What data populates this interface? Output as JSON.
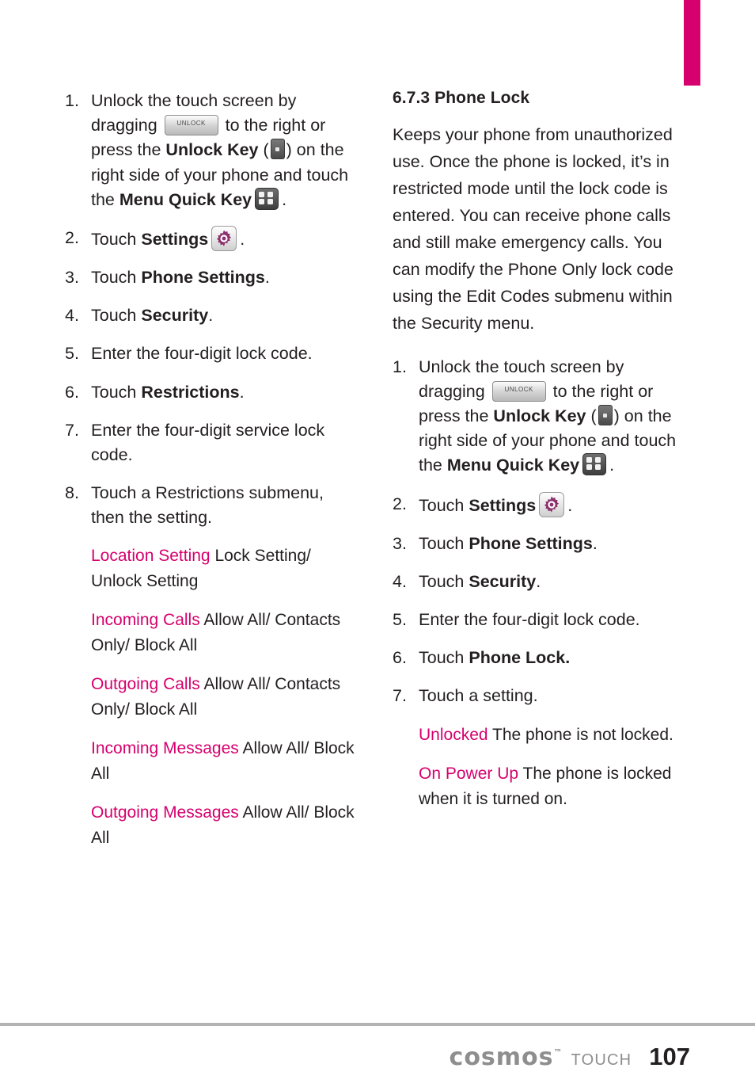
{
  "page": {
    "number": "107",
    "brand": "cosmos",
    "brand_sup": "™",
    "brand_suffix": "TOUCH"
  },
  "icons": {
    "unlock_chip_label": "UNLOCK",
    "unlock_key": "unlock-key-icon",
    "menu_quick_key": "menu-quick-key-icon",
    "settings_gear": "settings-gear-icon"
  },
  "left_column": {
    "steps": [
      {
        "num": "1.",
        "parts": [
          {
            "t": "text",
            "v": "Unlock the touch screen by dragging "
          },
          {
            "t": "icon",
            "v": "unlock-chip"
          },
          {
            "t": "text",
            "v": " to the right or press the "
          },
          {
            "t": "bold",
            "v": "Unlock Key"
          },
          {
            "t": "text",
            "v": " ("
          },
          {
            "t": "icon",
            "v": "key-chip"
          },
          {
            "t": "text",
            "v": ") on the right side of your phone and touch the "
          },
          {
            "t": "bold",
            "v": "Menu Quick Key"
          },
          {
            "t": "icon",
            "v": "menu-quick"
          },
          {
            "t": "text",
            "v": "."
          }
        ]
      },
      {
        "num": "2.",
        "parts": [
          {
            "t": "text",
            "v": "Touch "
          },
          {
            "t": "bold",
            "v": "Settings"
          },
          {
            "t": "icon",
            "v": "gear"
          },
          {
            "t": "text",
            "v": "."
          }
        ]
      },
      {
        "num": "3.",
        "parts": [
          {
            "t": "text",
            "v": "Touch "
          },
          {
            "t": "bold",
            "v": "Phone Settings"
          },
          {
            "t": "text",
            "v": "."
          }
        ]
      },
      {
        "num": "4.",
        "parts": [
          {
            "t": "text",
            "v": "Touch "
          },
          {
            "t": "bold",
            "v": "Security"
          },
          {
            "t": "text",
            "v": "."
          }
        ]
      },
      {
        "num": "5.",
        "parts": [
          {
            "t": "text",
            "v": "Enter the four-digit lock code."
          }
        ]
      },
      {
        "num": "6.",
        "parts": [
          {
            "t": "text",
            "v": "Touch "
          },
          {
            "t": "bold",
            "v": "Restrictions"
          },
          {
            "t": "text",
            "v": "."
          }
        ]
      },
      {
        "num": "7.",
        "parts": [
          {
            "t": "text",
            "v": "Enter the four-digit service lock code."
          }
        ]
      },
      {
        "num": "8.",
        "parts": [
          {
            "t": "text",
            "v": "Touch a Restrictions submenu, then the setting."
          }
        ]
      }
    ],
    "definitions": [
      {
        "term": "Location Setting",
        "desc": "Lock Setting/ Unlock Setting"
      },
      {
        "term": "Incoming Calls",
        "desc": "Allow All/ Contacts Only/ Block All"
      },
      {
        "term": "Outgoing Calls",
        "desc": "Allow All/ Contacts Only/ Block All"
      },
      {
        "term": "Incoming Messages",
        "desc": "Allow All/ Block All"
      },
      {
        "term": "Outgoing Messages",
        "desc": "Allow All/ Block All"
      }
    ]
  },
  "right_column": {
    "heading": "6.7.3 Phone Lock",
    "intro": "Keeps your phone from unauthorized use. Once the phone is locked, it’s in restricted mode until the lock code is entered. You can receive phone calls and still make emergency calls. You can modify the Phone Only lock code using the Edit Codes submenu within the Security menu.",
    "steps": [
      {
        "num": "1.",
        "parts": [
          {
            "t": "text",
            "v": "Unlock the touch screen by dragging "
          },
          {
            "t": "icon",
            "v": "unlock-chip"
          },
          {
            "t": "text",
            "v": " to the right or press the "
          },
          {
            "t": "bold",
            "v": "Unlock Key"
          },
          {
            "t": "text",
            "v": " ("
          },
          {
            "t": "icon",
            "v": "key-chip"
          },
          {
            "t": "text",
            "v": ") on the right side of your phone and touch the "
          },
          {
            "t": "bold",
            "v": "Menu Quick Key"
          },
          {
            "t": "icon",
            "v": "menu-quick"
          },
          {
            "t": "text",
            "v": "."
          }
        ]
      },
      {
        "num": "2.",
        "parts": [
          {
            "t": "text",
            "v": "Touch "
          },
          {
            "t": "bold",
            "v": "Settings"
          },
          {
            "t": "icon",
            "v": "gear"
          },
          {
            "t": "text",
            "v": "."
          }
        ]
      },
      {
        "num": "3.",
        "parts": [
          {
            "t": "text",
            "v": "Touch "
          },
          {
            "t": "bold",
            "v": "Phone Settings"
          },
          {
            "t": "text",
            "v": "."
          }
        ]
      },
      {
        "num": "4.",
        "parts": [
          {
            "t": "text",
            "v": "Touch "
          },
          {
            "t": "bold",
            "v": "Security"
          },
          {
            "t": "text",
            "v": "."
          }
        ]
      },
      {
        "num": "5.",
        "parts": [
          {
            "t": "text",
            "v": "Enter the four-digit lock code."
          }
        ]
      },
      {
        "num": "6.",
        "parts": [
          {
            "t": "text",
            "v": "Touch "
          },
          {
            "t": "bold",
            "v": "Phone Lock."
          }
        ]
      },
      {
        "num": "7.",
        "parts": [
          {
            "t": "text",
            "v": "Touch a setting."
          }
        ]
      }
    ],
    "definitions": [
      {
        "term": "Unlocked",
        "desc": "The phone is not locked."
      },
      {
        "term": "On Power Up",
        "desc": "The phone is locked when  it is turned on."
      }
    ]
  },
  "colors": {
    "accent": "#d6006e",
    "text": "#231f20",
    "footer_gray": "#8e8e8e",
    "rule": "#b3b3b3"
  }
}
